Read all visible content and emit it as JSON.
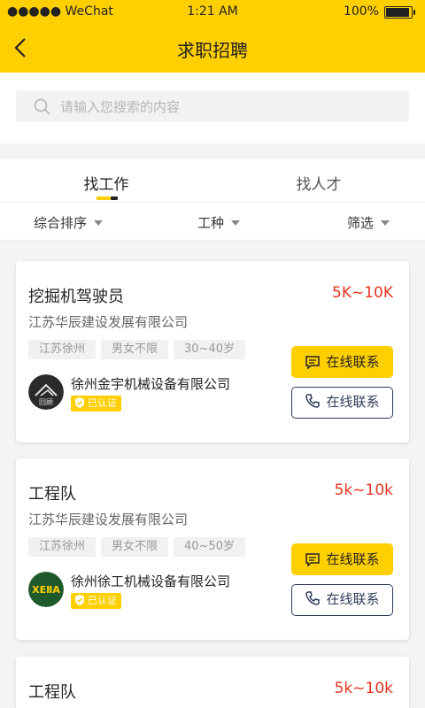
{
  "status_bar": {
    "carrier": "●●●●● WeChat",
    "time": "1:21 AM",
    "battery": "100%",
    "battery_level": 1.0
  },
  "nav": {
    "title": "求职招聘",
    "back_icon": "chevron-left-icon"
  },
  "search": {
    "placeholder": "请输入您搜索的内容",
    "icon": "search-icon"
  },
  "tabs": [
    {
      "label": "找工作",
      "active": true
    },
    {
      "label": "找人才",
      "active": false
    }
  ],
  "filters": [
    {
      "label": "综合排序"
    },
    {
      "label": "工种"
    },
    {
      "label": "筛选"
    }
  ],
  "jobs": [
    {
      "title": "挖掘机驾驶员",
      "salary": "5K~10K",
      "company": "江苏华辰建设发展有限公司",
      "tags": [
        "江苏徐州",
        "男女不限",
        "30~40岁"
      ],
      "poster": "徐州金宇机械设备有限公司",
      "badge": "已认证",
      "logo_text": "回顾",
      "chat_label": "在线联系",
      "call_label": "在线联系"
    },
    {
      "title": "工程队",
      "salary": "5k~10k",
      "company": "江苏华辰建设发展有限公司",
      "tags": [
        "江苏徐州",
        "男女不限",
        "40~50岁"
      ],
      "poster": "徐州徐工机械设备有限公司",
      "badge": "已认证",
      "logo_text": "XEⅡA",
      "chat_label": "在线联系",
      "call_label": "在线联系"
    },
    {
      "title": "工程队",
      "salary": "5k~10k"
    }
  ],
  "colors": {
    "accent": "#ffcf00",
    "salary": "#e8341e",
    "outline": "#2d3b5a"
  }
}
